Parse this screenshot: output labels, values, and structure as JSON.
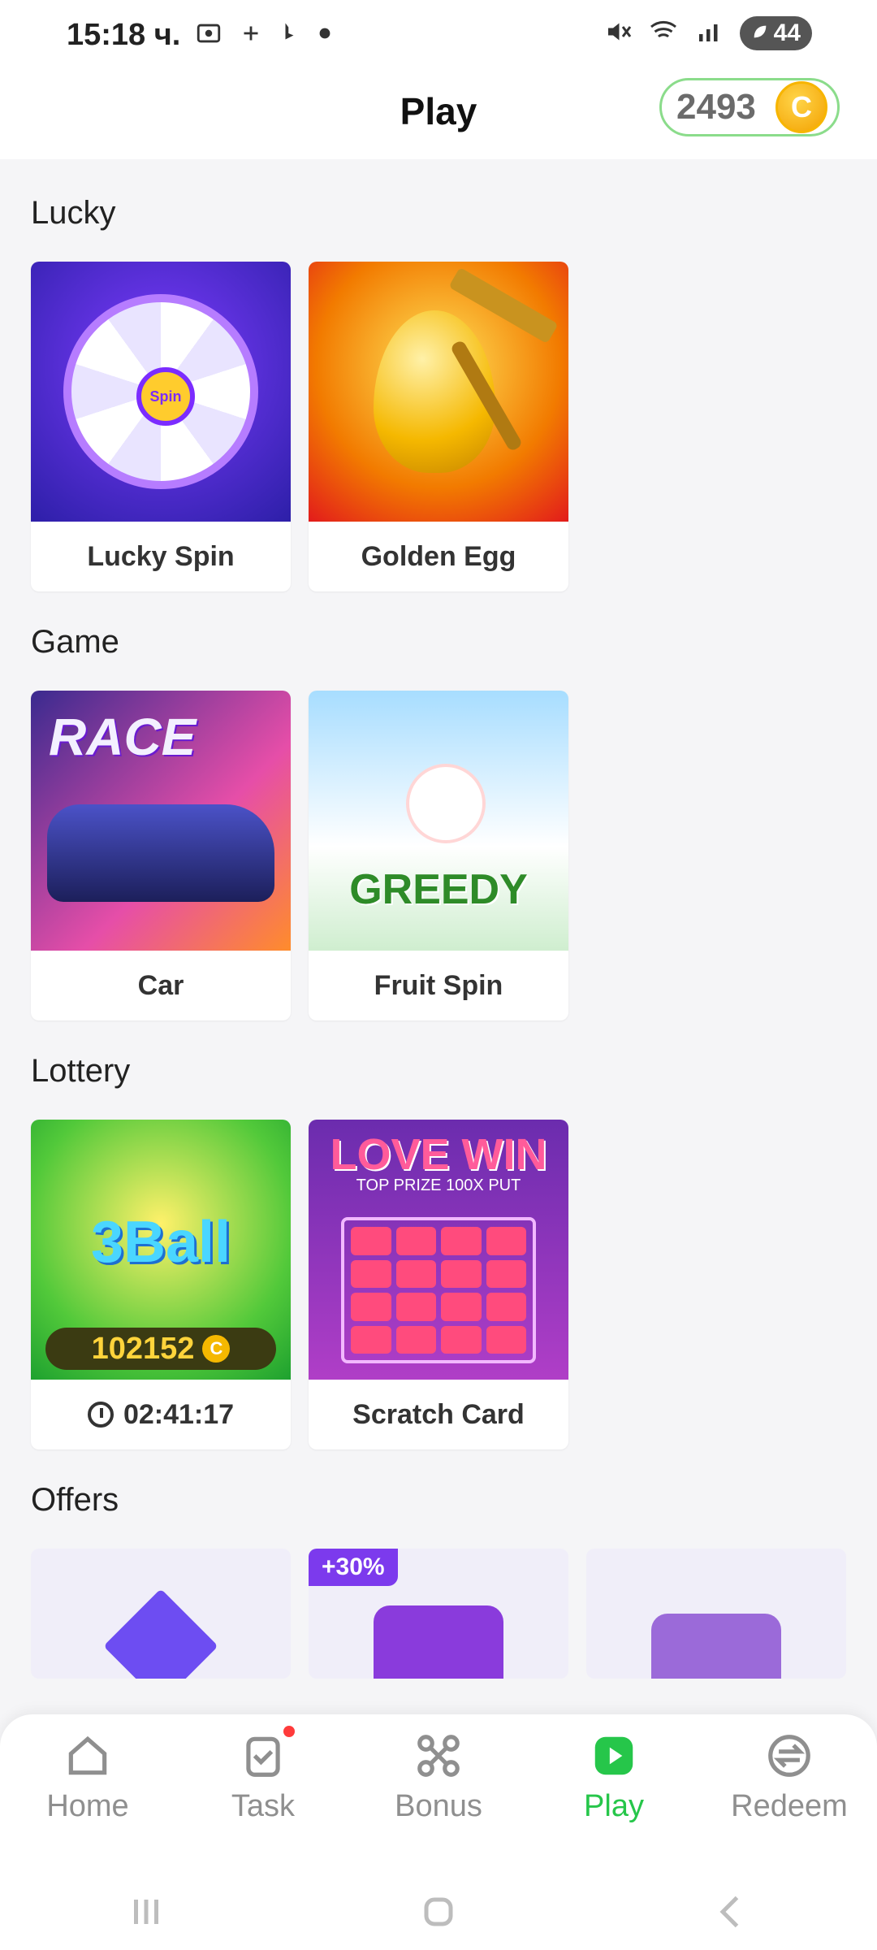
{
  "status_bar": {
    "time": "15:18 ч.",
    "battery": "44"
  },
  "header": {
    "title": "Play",
    "coins": "2493",
    "coin_symbol": "C"
  },
  "sections": {
    "lucky": {
      "title": "Lucky",
      "items": [
        {
          "label": "Lucky Spin",
          "art_text": "Spin"
        },
        {
          "label": "Golden Egg"
        }
      ]
    },
    "game": {
      "title": "Game",
      "items": [
        {
          "label": "Car",
          "art_text": "RACE"
        },
        {
          "label": "Fruit Spin",
          "art_text": "GREEDY"
        }
      ]
    },
    "lottery": {
      "title": "Lottery",
      "items": [
        {
          "label": "02:41:17",
          "art_text": "3Ball",
          "jackpot": "102152",
          "jackpot_symbol": "C"
        },
        {
          "label": "Scratch Card",
          "art_text": "LOVE WIN",
          "art_sub": "TOP PRIZE 100X PUT"
        }
      ]
    },
    "offers": {
      "title": "Offers",
      "items": [
        {
          "badge": ""
        },
        {
          "badge": "+30%"
        },
        {
          "badge": ""
        }
      ]
    }
  },
  "bottom_nav": {
    "items": [
      {
        "label": "Home",
        "icon": "home-icon"
      },
      {
        "label": "Task",
        "icon": "clipboard-check-icon"
      },
      {
        "label": "Bonus",
        "icon": "network-icon"
      },
      {
        "label": "Play",
        "icon": "play-icon"
      },
      {
        "label": "Redeem",
        "icon": "exchange-icon"
      }
    ],
    "active": "Play"
  },
  "colors": {
    "accent": "#26c64a",
    "muted": "#8f8f8f",
    "badge": "#7c3aed"
  }
}
